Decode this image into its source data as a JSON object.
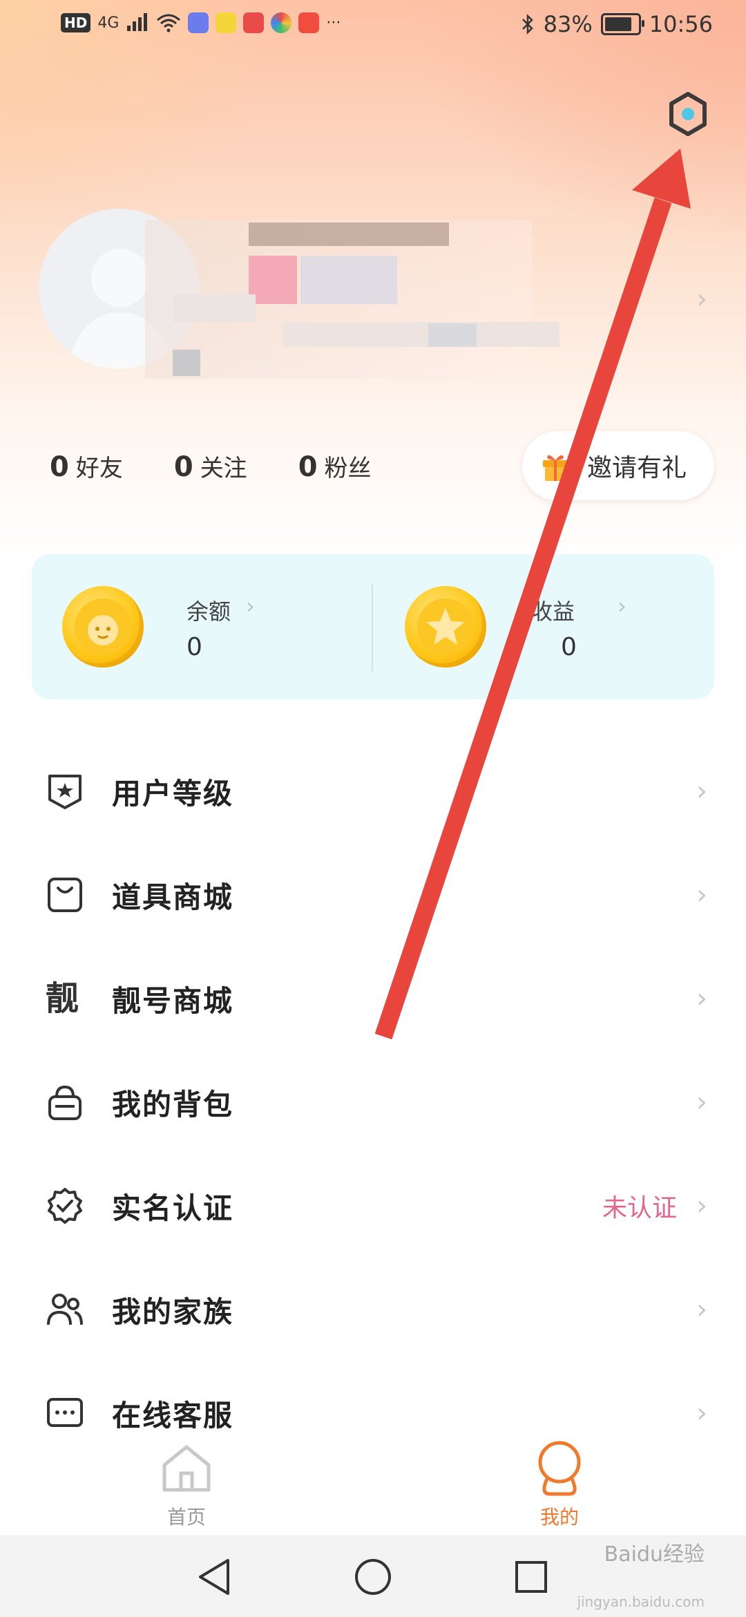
{
  "status_bar": {
    "left_hd": "HD",
    "left_net": "4G",
    "left_more": "···",
    "bluetooth_icon": "bluetooth-icon",
    "battery_pct": "83%",
    "battery_level": 0.83,
    "time": "10:56"
  },
  "header": {
    "settings_icon": "gear-icon"
  },
  "profile": {
    "chevron": "›"
  },
  "stats": [
    {
      "num": "0",
      "label": "好友"
    },
    {
      "num": "0",
      "label": "关注"
    },
    {
      "num": "0",
      "label": "粉丝"
    }
  ],
  "invite": {
    "label": "邀请有礼"
  },
  "wallet": {
    "balance": {
      "label": "余额",
      "value": "0"
    },
    "earnings": {
      "label": "收益",
      "value": "0"
    },
    "arrow": "›"
  },
  "menu": [
    {
      "label": "用户等级",
      "icon": "shield-star-icon"
    },
    {
      "label": "道具商城",
      "icon": "shopping-bag-icon"
    },
    {
      "label": "靓号商城",
      "icon": "liang-char-icon",
      "icon_text": "靓"
    },
    {
      "label": "我的背包",
      "icon": "backpack-icon"
    },
    {
      "label": "实名认证",
      "icon": "verified-badge-icon",
      "value": "未认证"
    },
    {
      "label": "我的家族",
      "icon": "family-icon"
    },
    {
      "label": "在线客服",
      "icon": "chat-icon"
    }
  ],
  "menu_chevron": "›",
  "tabs": [
    {
      "label": "首页",
      "icon": "home-icon",
      "active": false
    },
    {
      "label": "我的",
      "icon": "profile-tab-icon",
      "active": true
    }
  ],
  "colors": {
    "accent": "#f07a2c",
    "verify_pink": "#e4668a",
    "wallet_bg": "#e8f9fb",
    "annotation_red": "#e8453c"
  },
  "watermark": {
    "text": "Baidu经验",
    "sub": "jingyan.baidu.com"
  }
}
